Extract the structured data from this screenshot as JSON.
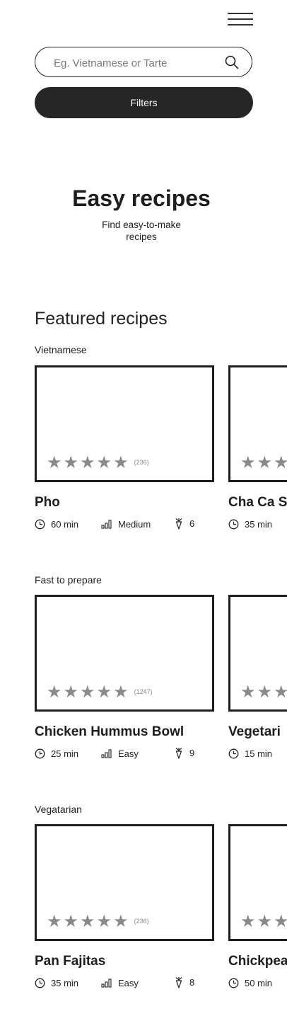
{
  "search": {
    "placeholder": "Eg. Vietnamese or Tarte"
  },
  "filters_label": "Filters",
  "hero": {
    "title": "Easy recipes",
    "subtitle": "Find easy-to-make recipes"
  },
  "featured_title": "Featured recipes",
  "rating": {
    "stars": 5,
    "star_color": "#8a8a8a"
  },
  "sections": [
    {
      "label": "Vietnamese",
      "cards": [
        {
          "title": "Pho",
          "rating_count": "(236)",
          "time": "60 min",
          "difficulty": "Medium",
          "servings": "6"
        },
        {
          "title": "Cha Ca S",
          "time": "35 min"
        }
      ]
    },
    {
      "label": "Fast to prepare",
      "cards": [
        {
          "title": "Chicken Hummus Bowl",
          "rating_count": "(1247)",
          "time": "25 min",
          "difficulty": "Easy",
          "servings": "9"
        },
        {
          "title": "Vegetari",
          "time": "15 min"
        }
      ]
    },
    {
      "label": "Vegatarian",
      "cards": [
        {
          "title": "Pan Fajitas",
          "rating_count": "(236)",
          "time": "35 min",
          "difficulty": "Easy",
          "servings": "8"
        },
        {
          "title": "Chickpea",
          "time": "50 min"
        }
      ]
    }
  ]
}
